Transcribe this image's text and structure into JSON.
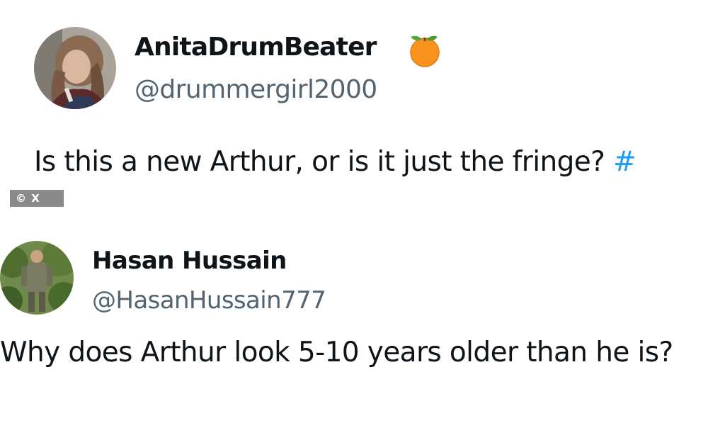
{
  "tweets": [
    {
      "display_name": "AnitaDrumBeater",
      "handle": "@drummergirl2000",
      "text": "Is this a new Arthur, or is it just the fringe? ",
      "hashtag_fragment": "#",
      "badge_icon": "orange-emoji-icon"
    },
    {
      "display_name": "Hasan Hussain",
      "handle": "@HasanHussain777",
      "text": "Why does Arthur look 5-10 years older than he is?"
    }
  ],
  "watermark": "© X",
  "colors": {
    "name": "#0f1419",
    "handle": "#536471",
    "hashtag": "#1d9bf0",
    "watermark_bg": "#8a8a8a"
  }
}
